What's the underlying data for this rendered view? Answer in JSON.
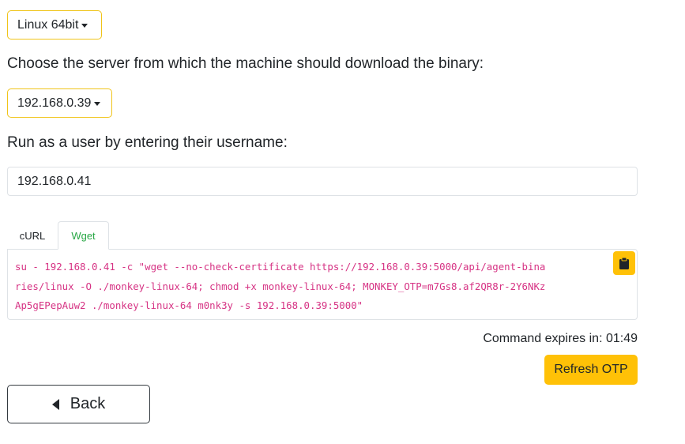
{
  "os_dropdown": {
    "selected": "Linux 64bit",
    "icon": "caret-down-icon"
  },
  "server_prompt": "Choose the server from which the machine should download the binary:",
  "server_dropdown": {
    "selected": "192.168.0.39",
    "icon": "caret-down-icon"
  },
  "user_prompt": "Run as a user by entering their username:",
  "username_input": {
    "value": "192.168.0.41"
  },
  "tabs": [
    {
      "label": "cURL",
      "active": false
    },
    {
      "label": "Wget",
      "active": true
    }
  ],
  "command": {
    "text": "su - 192.168.0.41 -c \"wget --no-check-certificate https://192.168.0.39:5000/api/agent-binaries/linux -O ./monkey-linux-64; chmod +x monkey-linux-64; MONKEY_OTP=m7Gs8.af2QR8r-2Y6NKzAp5gEPepAuw2 ./monkey-linux-64 m0nk3y -s 192.168.0.39:5000\"",
    "copy_icon": "clipboard-icon"
  },
  "expiry_text": "Command expires in: 01:49",
  "refresh_label": "Refresh OTP",
  "back_label": "Back",
  "colors": {
    "accent": "#ffc107",
    "dropdown_border": "#f0c419",
    "active_tab": "#28a745",
    "code": "#d63384"
  }
}
